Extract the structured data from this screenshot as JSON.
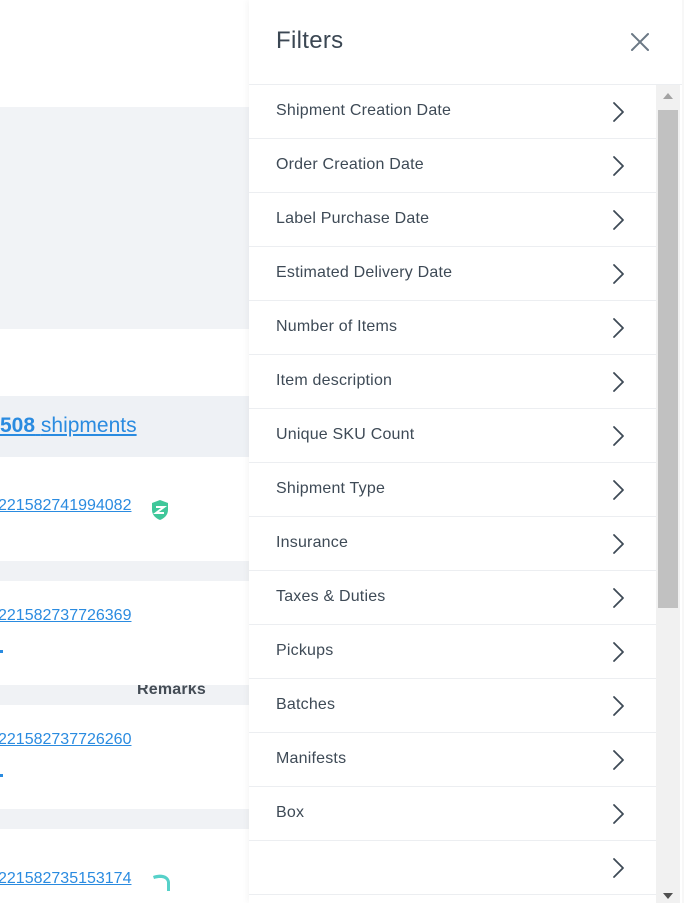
{
  "background": {
    "table_header_remarks": "Remarks",
    "shipments_count_number": "508",
    "shipments_count_label": "shipments",
    "rows": [
      {
        "tracking": "221582741994082",
        "badge": "shield-badge-icon"
      },
      {
        "tracking": "221582737726369",
        "badge": null
      },
      {
        "tracking": "221582737726260",
        "badge": null
      },
      {
        "tracking": "221582735153174",
        "badge": "boomerang-badge-icon"
      }
    ]
  },
  "filters_panel": {
    "title": "Filters",
    "close_icon": "close-icon",
    "items": [
      {
        "label": "Shipment Creation Date"
      },
      {
        "label": "Order Creation Date"
      },
      {
        "label": "Label Purchase Date"
      },
      {
        "label": "Estimated Delivery Date"
      },
      {
        "label": "Number of Items"
      },
      {
        "label": "Item description"
      },
      {
        "label": "Unique SKU Count"
      },
      {
        "label": "Shipment Type"
      },
      {
        "label": "Insurance"
      },
      {
        "label": "Taxes & Duties"
      },
      {
        "label": "Pickups"
      },
      {
        "label": "Batches"
      },
      {
        "label": "Manifests"
      },
      {
        "label": "Box"
      },
      {
        "label": ""
      }
    ]
  },
  "colors": {
    "link": "#2a8be0",
    "text": "#3e4a56",
    "divider": "#eceef1",
    "badge_green": "#3fc79a",
    "badge_teal": "#56d1c9"
  }
}
